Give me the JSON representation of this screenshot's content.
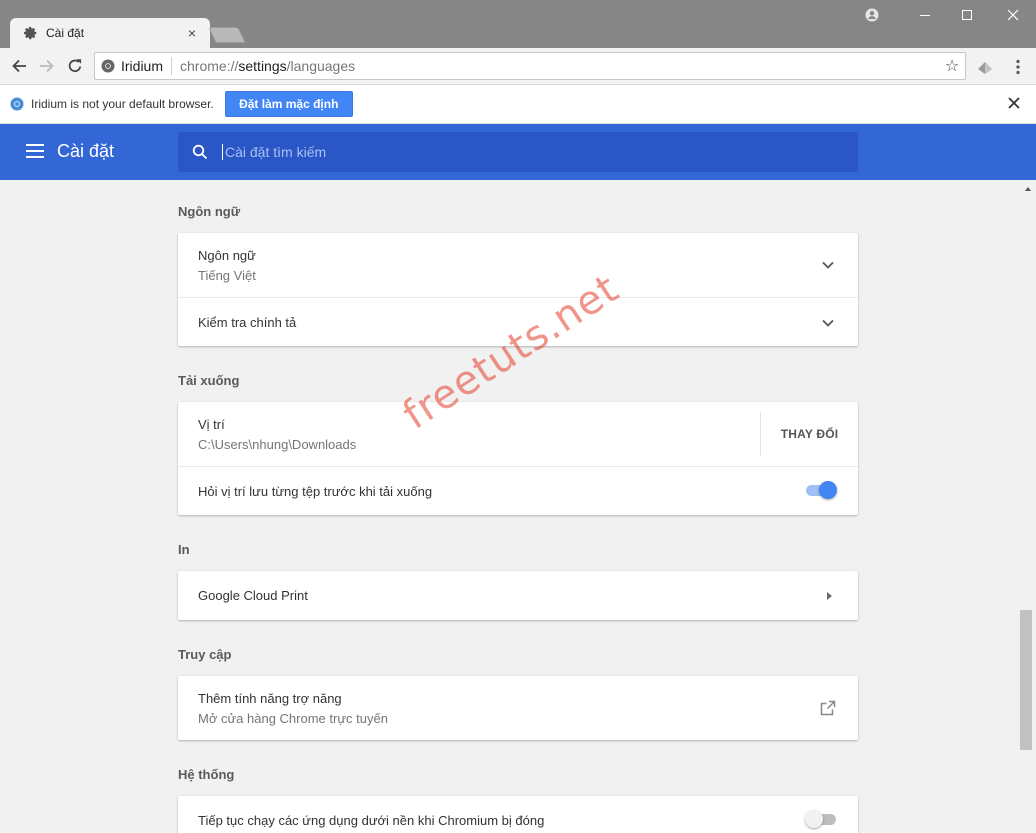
{
  "window": {
    "tab_title": "Cài đặt",
    "tab_close": "×"
  },
  "toolbar": {
    "site_name": "Iridium",
    "url_scheme": "chrome://",
    "url_host": "settings",
    "url_path": "/languages",
    "bookmark_star": "☆"
  },
  "infobar": {
    "message": "Iridium is not your default browser.",
    "button": "Đặt làm mặc định"
  },
  "header": {
    "title": "Cài đặt",
    "search_placeholder": "Cài đặt tìm kiếm"
  },
  "sections": {
    "languages": {
      "title": "Ngôn ngữ",
      "language_label": "Ngôn ngữ",
      "language_value": "Tiếng Việt",
      "spellcheck_label": "Kiểm tra chính tả"
    },
    "downloads": {
      "title": "Tải xuống",
      "location_label": "Vị trí",
      "location_value": "C:\\Users\\nhung\\Downloads",
      "change_button": "THAY ĐỔI",
      "ask_label": "Hỏi vị trí lưu từng tệp trước khi tải xuống",
      "ask_enabled": true
    },
    "printing": {
      "title": "In",
      "cloud_print_label": "Google Cloud Print"
    },
    "accessibility": {
      "title": "Truy cập",
      "add_features_label": "Thêm tính năng trợ năng",
      "add_features_sub": "Mở cửa hàng Chrome trực tuyến"
    },
    "system": {
      "title": "Hệ thống",
      "background_apps_label": "Tiếp tục chạy các ứng dụng dưới nền khi Chromium bị đóng",
      "background_apps_enabled": false
    }
  },
  "watermark": "freetuts.net",
  "colors": {
    "header_blue": "#3367d6",
    "search_blue": "#2a56c6",
    "button_blue": "#4285f4",
    "toggle_on_track": "#9fbff6",
    "toggle_on_knob": "#4285f4",
    "toggle_off_track": "#bdbdbd",
    "toggle_off_knob": "#f1f1f1"
  }
}
